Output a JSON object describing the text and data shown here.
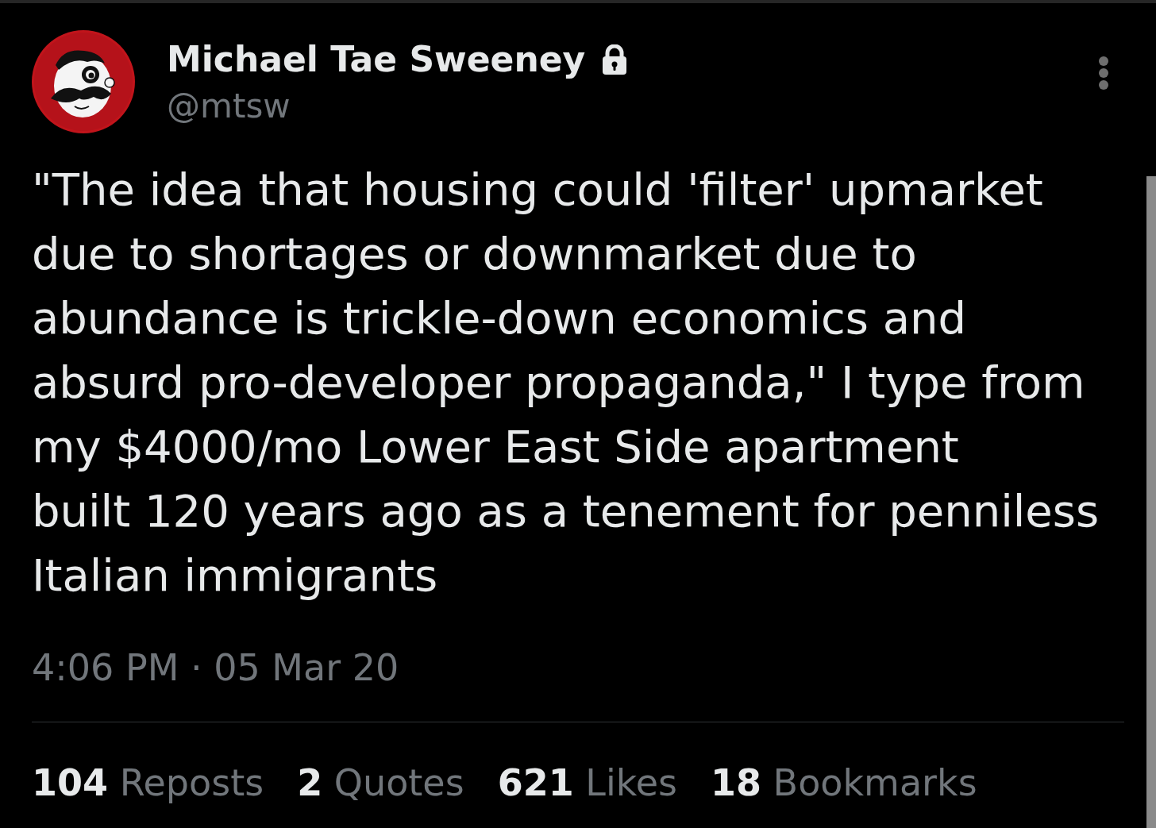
{
  "author": {
    "name": "Michael Tae Sweeney",
    "handle": "@mtsw",
    "protected": true
  },
  "tweet": {
    "text": "\"The idea that housing could 'filter' upmarket\ndue to shortages or downmarket due to\nabundance is trickle-down economics and\nabsurd pro-developer propaganda,\" I type from\nmy $4000/mo Lower East Side apartment\nbuilt 120 years ago as a tenement for penniless\nItalian immigrants",
    "timestamp": "4:06 PM · 05 Mar 20"
  },
  "stats": [
    {
      "count": "104",
      "label": "Reposts"
    },
    {
      "count": "2",
      "label": "Quotes"
    },
    {
      "count": "621",
      "label": "Likes"
    },
    {
      "count": "18",
      "label": "Bookmarks"
    }
  ]
}
